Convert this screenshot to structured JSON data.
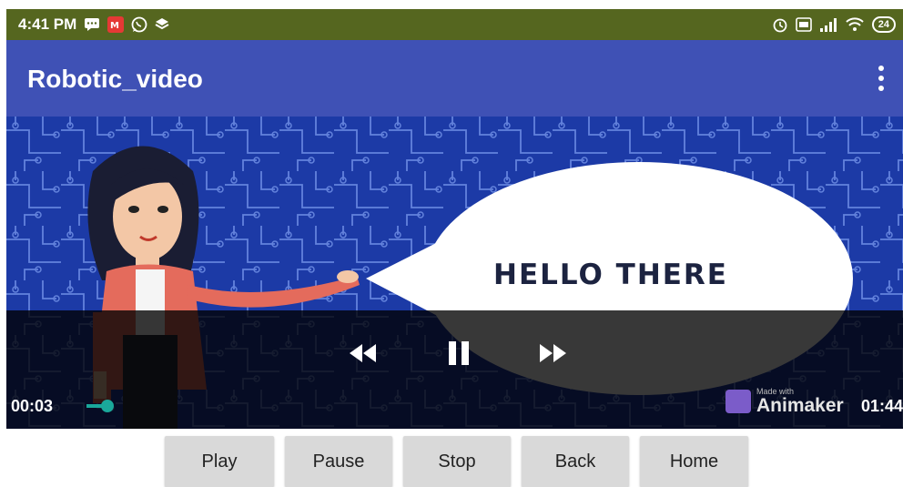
{
  "status_bar": {
    "time": "4:41 PM",
    "battery": "24",
    "left_icons": [
      "message-icon",
      "mi-app-icon",
      "whatsapp-icon",
      "layers-icon"
    ],
    "right_icons": [
      "alarm-icon",
      "volte-icon",
      "signal-icon",
      "wifi-icon",
      "battery-icon"
    ]
  },
  "app_bar": {
    "title": "Robotic_video",
    "menu_icon": "overflow-menu-icon"
  },
  "video": {
    "speech_text": "HELLO THERE",
    "current_time": "00:03",
    "duration": "01:44",
    "progress": 0.03,
    "watermark_small": "Made with",
    "watermark_brand": "Animaker",
    "controls": [
      "rewind-icon",
      "pause-icon",
      "fast-forward-icon"
    ]
  },
  "buttons": {
    "play": "Play",
    "pause": "Pause",
    "stop": "Stop",
    "back": "Back",
    "home": "Home"
  }
}
